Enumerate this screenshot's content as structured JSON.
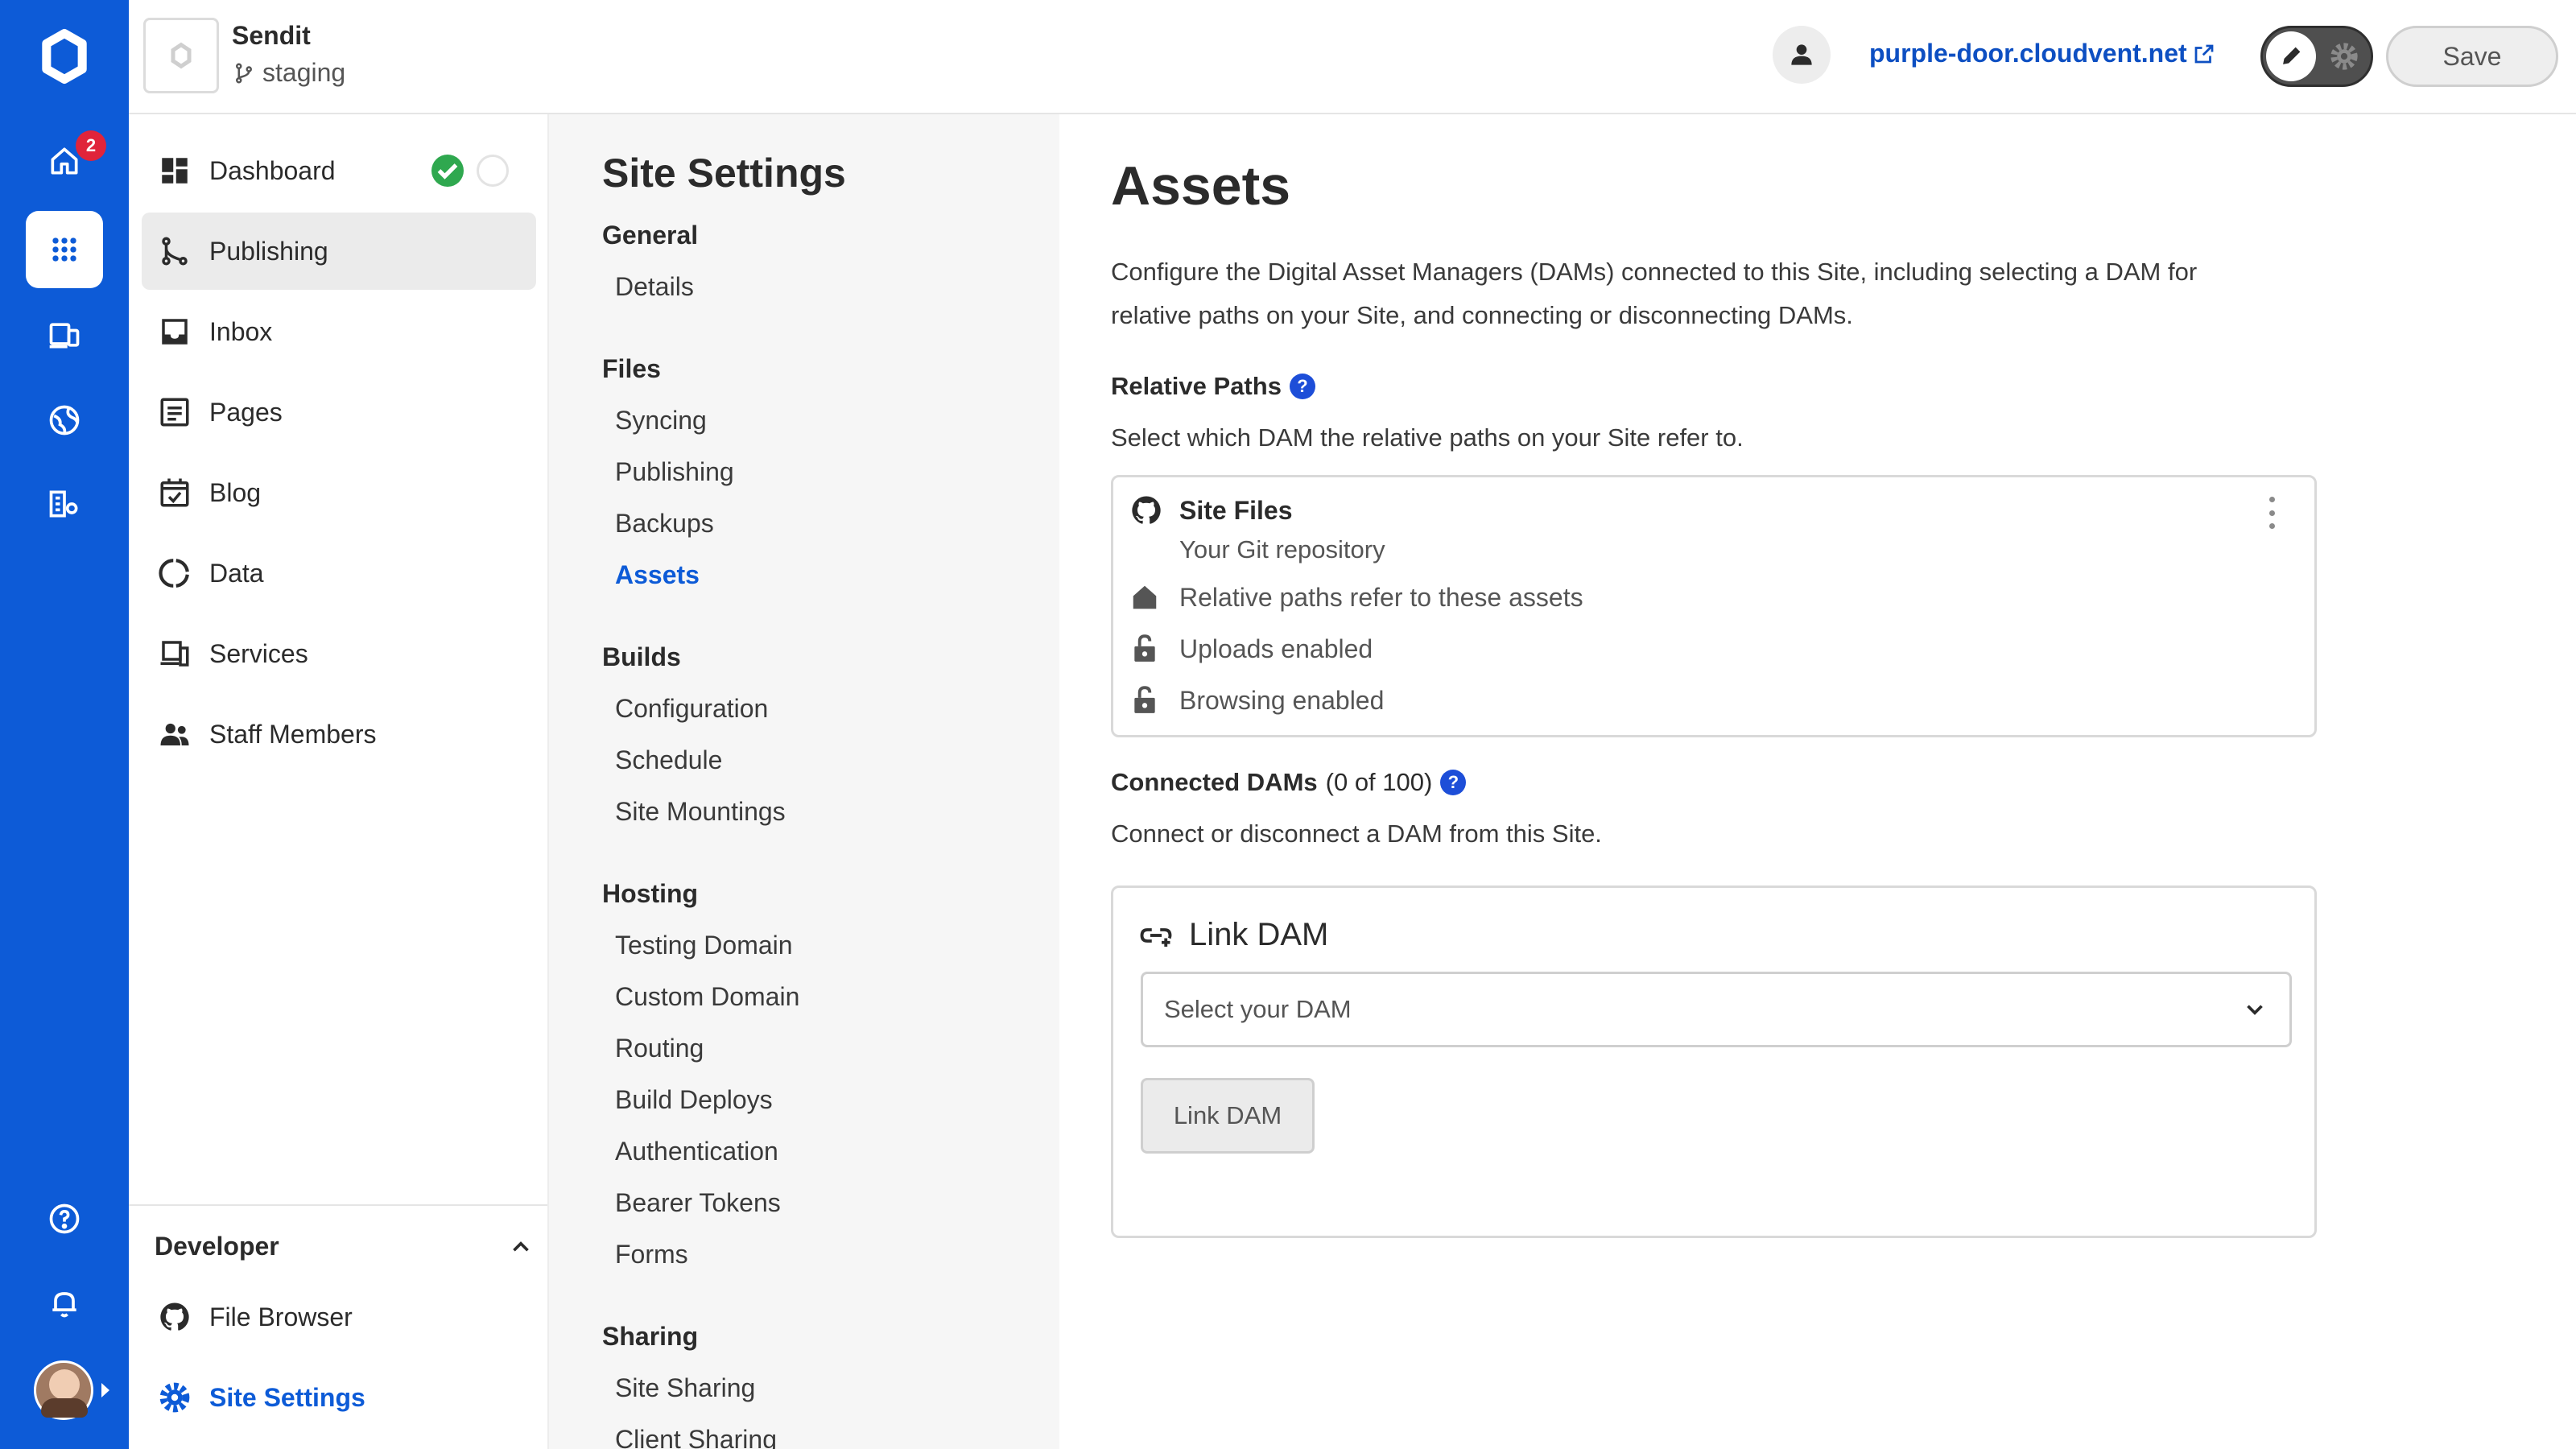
{
  "rail": {
    "home_badge": "2"
  },
  "header": {
    "site_name": "Sendit",
    "branch": "staging",
    "site_url": "purple-door.cloudvent.net",
    "save_label": "Save"
  },
  "leftnav": {
    "items": [
      {
        "label": "Dashboard"
      },
      {
        "label": "Publishing"
      },
      {
        "label": "Inbox"
      },
      {
        "label": "Pages"
      },
      {
        "label": "Blog"
      },
      {
        "label": "Data"
      },
      {
        "label": "Services"
      },
      {
        "label": "Staff Members"
      }
    ],
    "developer": {
      "title": "Developer",
      "items": [
        {
          "label": "File Browser"
        },
        {
          "label": "Site Settings"
        }
      ]
    }
  },
  "settings_menu": {
    "title": "Site Settings",
    "groups": [
      {
        "title": "General",
        "items": [
          "Details"
        ]
      },
      {
        "title": "Files",
        "items": [
          "Syncing",
          "Publishing",
          "Backups",
          "Assets"
        ]
      },
      {
        "title": "Builds",
        "items": [
          "Configuration",
          "Schedule",
          "Site Mountings"
        ]
      },
      {
        "title": "Hosting",
        "items": [
          "Testing Domain",
          "Custom Domain",
          "Routing",
          "Build Deploys",
          "Authentication",
          "Bearer Tokens",
          "Forms"
        ]
      },
      {
        "title": "Sharing",
        "items": [
          "Site Sharing",
          "Client Sharing"
        ]
      }
    ]
  },
  "main": {
    "title": "Assets",
    "description_line1": "Configure the Digital Asset Managers (DAMs) connected to this Site, including selecting a DAM for",
    "description_line2": "relative paths on your Site, and connecting or disconnecting DAMs.",
    "relative_paths": {
      "heading": "Relative Paths",
      "subtitle": "Select which DAM the relative paths on your Site refer to.",
      "card": {
        "name": "Site Files",
        "description": "Your Git repository",
        "features": [
          "Relative paths refer to these assets",
          "Uploads enabled",
          "Browsing enabled"
        ]
      }
    },
    "connected": {
      "heading": "Connected DAMs",
      "count": "(0 of 100)",
      "subtitle": "Connect or disconnect a DAM from this Site.",
      "link_title": "Link DAM",
      "select_placeholder": "Select your DAM",
      "link_button": "Link DAM"
    }
  }
}
